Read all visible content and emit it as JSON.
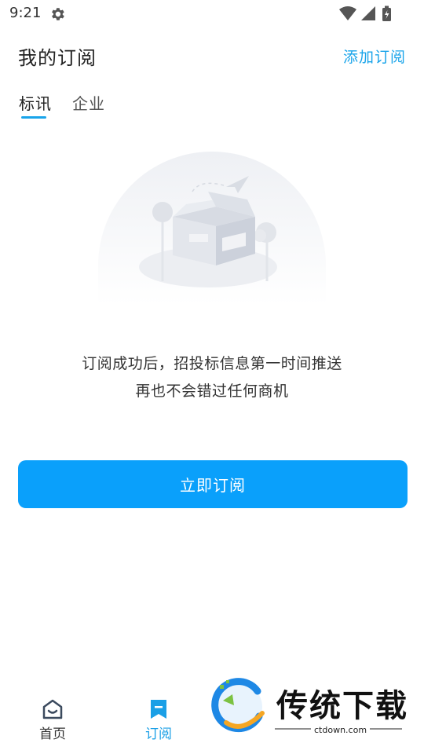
{
  "status_bar": {
    "time": "9:21"
  },
  "header": {
    "title": "我的订阅",
    "action_label": "添加订阅"
  },
  "tabs": [
    {
      "label": "标讯",
      "active": true
    },
    {
      "label": "企业",
      "active": false
    }
  ],
  "empty_state": {
    "line1": "订阅成功后，招投标信息第一时间推送",
    "line2": "再也不会错过任何商机"
  },
  "primary_button": {
    "label": "立即订阅"
  },
  "bottom_nav": {
    "items": [
      {
        "label": "首页",
        "icon": "home-icon",
        "active": false
      },
      {
        "label": "订阅",
        "icon": "bookmark-icon",
        "active": true
      }
    ]
  },
  "watermark": {
    "text": "传统下载",
    "url_text": "ctdown.com"
  },
  "colors": {
    "accent": "#19a4ea",
    "button": "#0aa0fb"
  }
}
